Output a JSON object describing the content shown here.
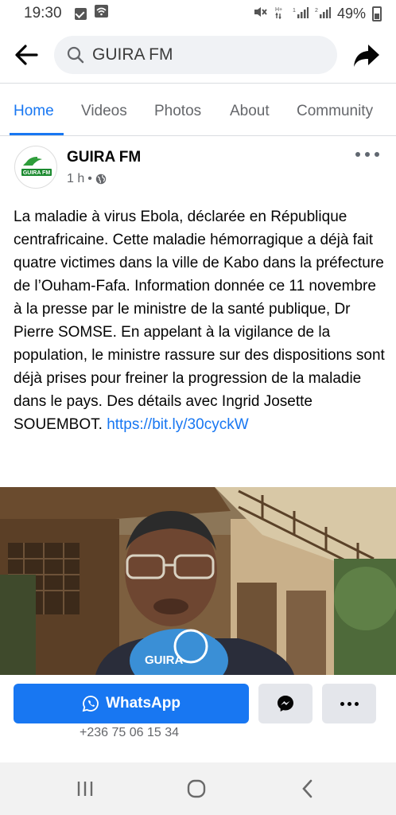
{
  "status": {
    "time": "19:30",
    "battery": "49%"
  },
  "search": {
    "value": "GUIRA FM"
  },
  "tabs": [
    {
      "label": "Home",
      "active": true
    },
    {
      "label": "Videos",
      "active": false
    },
    {
      "label": "Photos",
      "active": false
    },
    {
      "label": "About",
      "active": false
    },
    {
      "label": "Community",
      "active": false
    }
  ],
  "post": {
    "page_name": "GUIRA FM",
    "time_ago": "1 h",
    "separator": "•",
    "avatar_text": "GUIRA FM",
    "text": "La maladie à virus Ebola, déclarée en République centrafricaine. Cette maladie hémorragique a déjà fait quatre victimes dans la ville de Kabo dans la préfecture de l’Ouham-Fafa. Information donnée ce 11 novembre à la presse par le ministre de la santé publique, Dr Pierre SOMSE. En appelant à la vigilance de la population, le ministre rassure sur des dispositions sont déjà prises pour freiner la progression de la maladie dans le pays. Des détails avec Ingrid Josette SOUEMBOT.",
    "link": "https://bit.ly/30cyckW",
    "mic_text": "GUIRA"
  },
  "actions": {
    "whatsapp_label": "WhatsApp",
    "phone": "+236 75 06 15 34"
  },
  "colors": {
    "accent": "#1877f2",
    "secondary_button": "#e4e6eb",
    "muted_text": "#65676b"
  },
  "icons": {
    "back": "arrow-left-icon",
    "search": "search-icon",
    "share": "share-arrow-icon",
    "more": "more-horizontal-icon",
    "globe": "globe-icon",
    "whatsapp": "whatsapp-icon",
    "messenger": "messenger-icon",
    "nav_recent": "recent-apps-icon",
    "nav_home": "home-circle-icon",
    "nav_back": "chevron-left-icon"
  }
}
